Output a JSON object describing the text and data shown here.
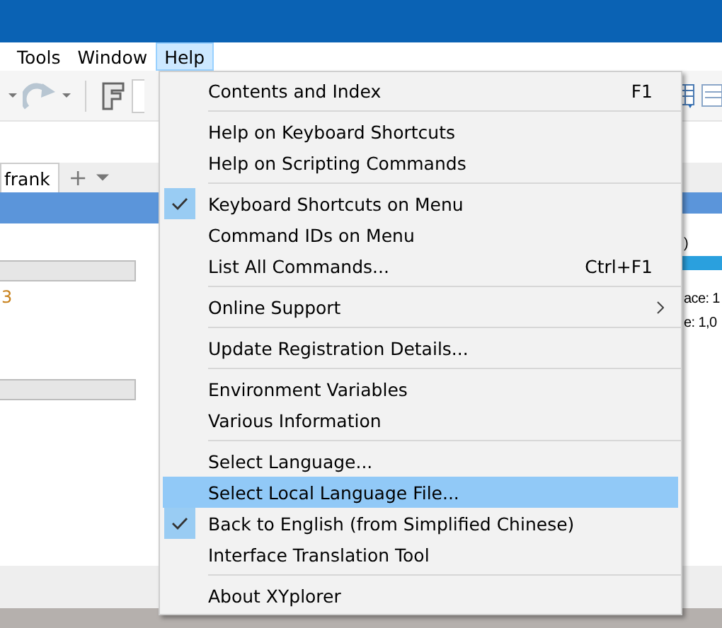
{
  "menubar": [
    {
      "label": "Tools",
      "selected": false
    },
    {
      "label": "Window",
      "selected": false
    },
    {
      "label": "Help",
      "selected": true
    }
  ],
  "tab": {
    "label": "frank",
    "add": "+"
  },
  "left_panel": {
    "text_1": "3"
  },
  "right_panel": {
    "text_1": ")",
    "text_2": "ace: 1",
    "text_3": "e: 1,0"
  },
  "help_menu": [
    {
      "kind": "item",
      "label": "Contents and Index",
      "shortcut": "F1",
      "checked": false,
      "selected": false
    },
    {
      "kind": "separator"
    },
    {
      "kind": "item",
      "label": "Help on Keyboard Shortcuts",
      "checked": false,
      "selected": false
    },
    {
      "kind": "item",
      "label": "Help on Scripting Commands",
      "checked": false,
      "selected": false
    },
    {
      "kind": "separator"
    },
    {
      "kind": "item",
      "label": "Keyboard Shortcuts on Menu",
      "checked": true,
      "selected": false
    },
    {
      "kind": "item",
      "label": "Command IDs on Menu",
      "checked": false,
      "selected": false
    },
    {
      "kind": "item",
      "label": "List All Commands...",
      "shortcut": "Ctrl+F1",
      "checked": false,
      "selected": false
    },
    {
      "kind": "separator"
    },
    {
      "kind": "submenu",
      "label": "Online Support",
      "checked": false,
      "selected": false
    },
    {
      "kind": "separator"
    },
    {
      "kind": "item",
      "label": "Update Registration Details...",
      "checked": false,
      "selected": false
    },
    {
      "kind": "separator"
    },
    {
      "kind": "item",
      "label": "Environment Variables",
      "checked": false,
      "selected": false
    },
    {
      "kind": "item",
      "label": "Various Information",
      "checked": false,
      "selected": false
    },
    {
      "kind": "separator"
    },
    {
      "kind": "item",
      "label": "Select Language...",
      "checked": false,
      "selected": false
    },
    {
      "kind": "item",
      "label": "Select Local Language File...",
      "checked": false,
      "selected": true
    },
    {
      "kind": "item",
      "label": "Back to English (from Simplified Chinese)",
      "checked": true,
      "selected": false
    },
    {
      "kind": "item",
      "label": "Interface Translation Tool",
      "checked": false,
      "selected": false
    },
    {
      "kind": "separator"
    },
    {
      "kind": "item",
      "label": "About XYplorer",
      "checked": false,
      "selected": false
    }
  ]
}
